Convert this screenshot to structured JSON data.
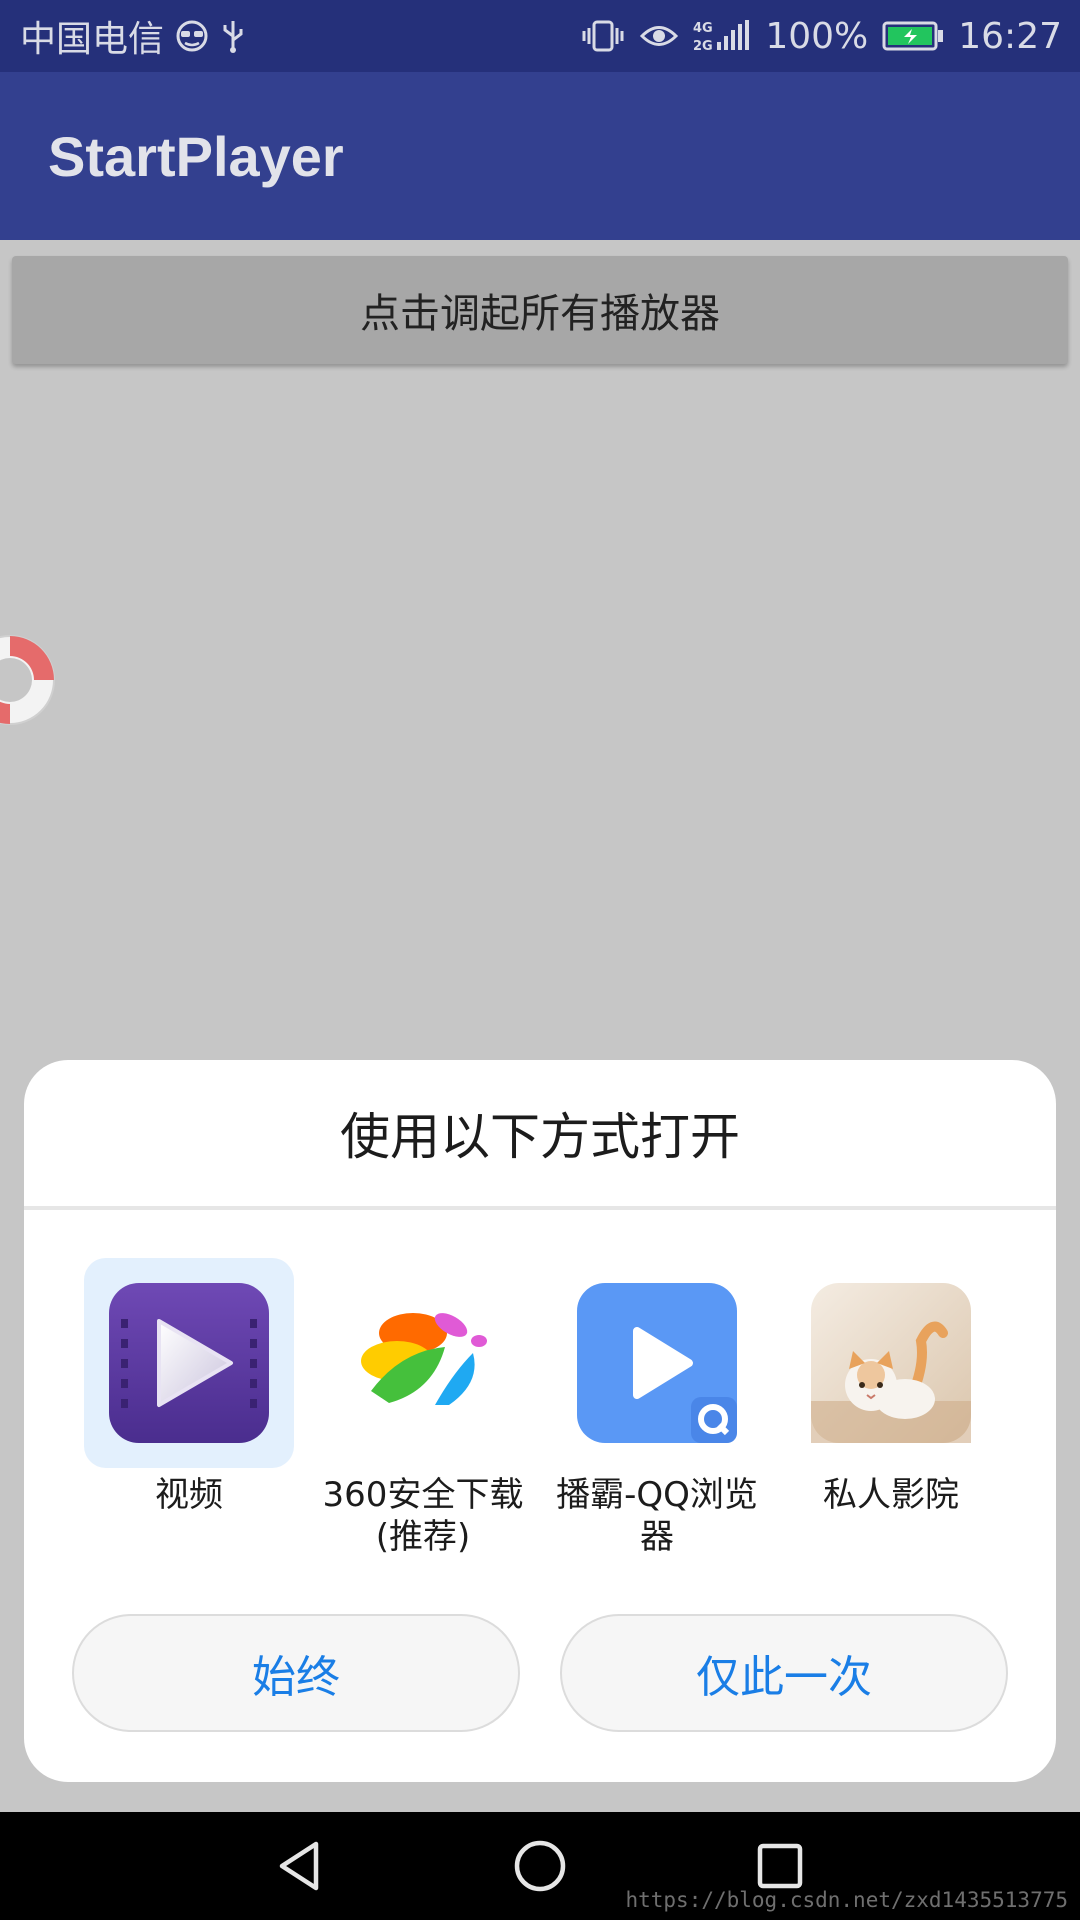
{
  "status_bar": {
    "carrier": "中国电信",
    "network_type": "4G 2G",
    "battery_percent": "100%",
    "time": "16:27",
    "icons": [
      "glasses-icon",
      "usb-icon",
      "vibrate-icon",
      "eye-icon",
      "signal-icon",
      "battery-charging-icon"
    ]
  },
  "app_bar": {
    "title": "StartPlayer"
  },
  "main": {
    "launch_button_label": "点击调起所有播放器"
  },
  "floating_icon": "lifebuoy-icon",
  "dialog": {
    "title": "使用以下方式打开",
    "apps": [
      {
        "label": "视频",
        "icon": "video-app-icon",
        "selected": true
      },
      {
        "label": "360安全下载\n(推荐)",
        "icon": "360-download-icon",
        "selected": false
      },
      {
        "label": "播霸-QQ浏览\n器",
        "icon": "qq-browser-player-icon",
        "selected": false
      },
      {
        "label": "私人影院",
        "icon": "private-cinema-icon",
        "selected": false
      }
    ],
    "always_label": "始终",
    "once_label": "仅此一次"
  },
  "nav_bar": {
    "buttons": [
      "back-icon",
      "home-icon",
      "recents-icon"
    ]
  },
  "watermark": "https://blog.csdn.net/zxd1435513775",
  "colors": {
    "status_bar": "#25307a",
    "app_bar": "#33408f",
    "accent_text": "#1a7ee6",
    "scrim_background": "#c6c6c6"
  }
}
